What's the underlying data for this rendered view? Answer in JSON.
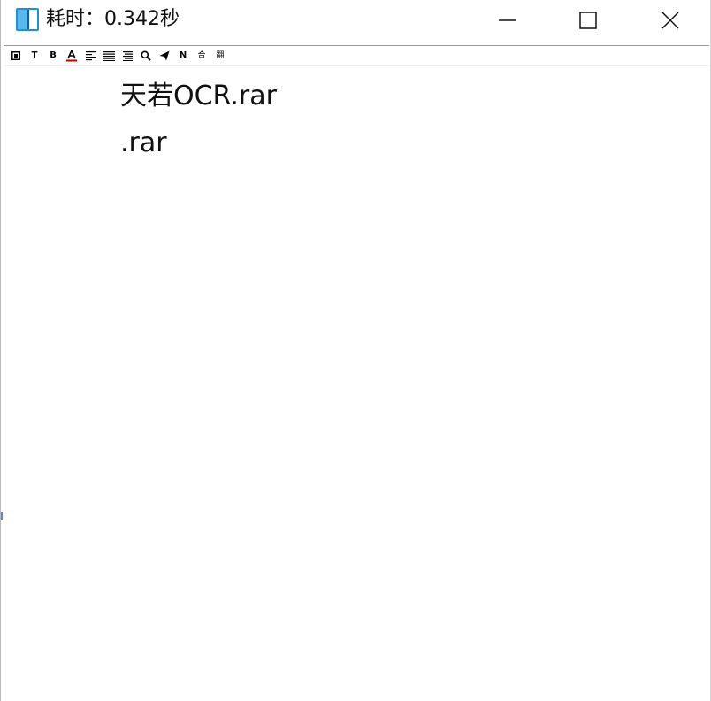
{
  "window": {
    "title": "耗时：0.342秒",
    "icon": "book-app-icon",
    "controls": {
      "minimize_icon": "minimize-icon",
      "maximize_icon": "maximize-icon",
      "close_icon": "close-icon"
    }
  },
  "toolbar": {
    "items": [
      {
        "name": "frame-icon",
        "glyph": "▣"
      },
      {
        "name": "text-icon",
        "glyph": "T"
      },
      {
        "name": "bold-icon",
        "glyph": "B"
      },
      {
        "name": "font-color-icon",
        "glyph": "A"
      },
      {
        "name": "align-left-icon",
        "glyph": "≡"
      },
      {
        "name": "align-justify-icon",
        "glyph": "≣"
      },
      {
        "name": "align-right-icon",
        "glyph": "≣"
      },
      {
        "name": "search-icon",
        "glyph": "search"
      },
      {
        "name": "send-icon",
        "glyph": "send"
      },
      {
        "name": "n-icon",
        "glyph": "N"
      },
      {
        "name": "merge-icon",
        "glyph": "合"
      },
      {
        "name": "translate-icon",
        "glyph": "翻"
      }
    ],
    "accent_color": "#c00000"
  },
  "content": {
    "lines": [
      "天若OCR.rar",
      ".rar"
    ]
  }
}
